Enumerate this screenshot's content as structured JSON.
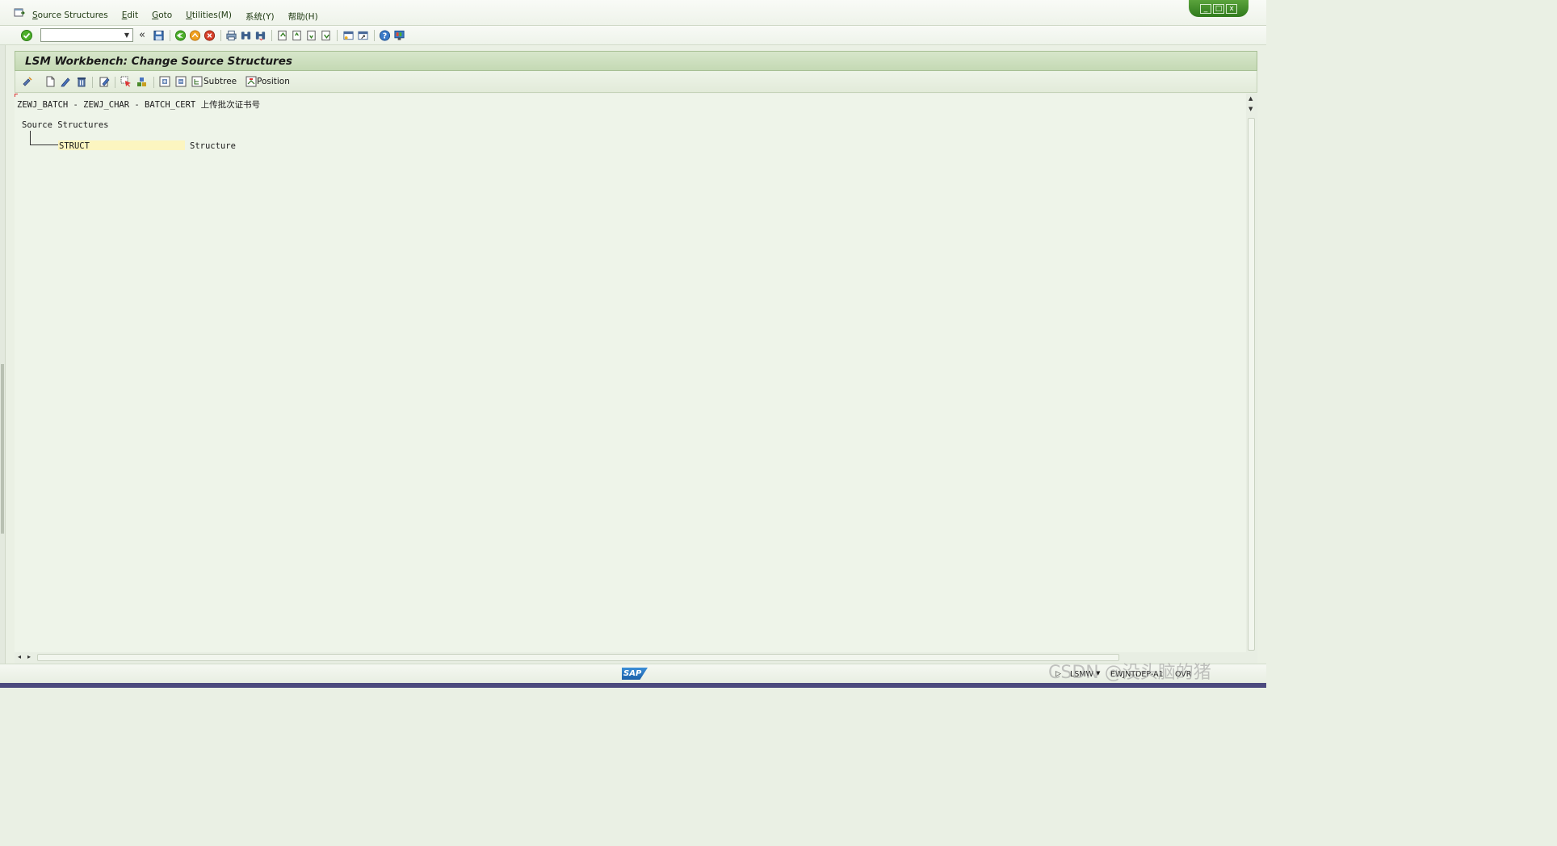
{
  "menu": {
    "items": [
      {
        "label": "Source Structures",
        "ul": "S"
      },
      {
        "label": "Edit",
        "ul": "E"
      },
      {
        "label": "Goto",
        "ul": "G"
      },
      {
        "label": "Utilities(M)",
        "ul": "U"
      },
      {
        "label": "系统(Y)",
        "ul": ""
      },
      {
        "label": "帮助(H)",
        "ul": ""
      }
    ]
  },
  "window": {
    "min": "_",
    "max": "□",
    "close": "x"
  },
  "toolbar": {
    "command_value": "",
    "back_glyph": "«"
  },
  "page": {
    "title": "LSM Workbench: Change Source Structures"
  },
  "app_toolbar": {
    "subtree_label": "Subtree",
    "position_label": "Position"
  },
  "content": {
    "header_line": "ZEWJ_BATCH - ZEWJ_CHAR - BATCH_CERT 上传批次证书号",
    "tree_root": "Source Structures",
    "struct_name": "STRUCT",
    "struct_desc": "Structure"
  },
  "status": {
    "transaction": "LSMW",
    "server": "EWJNTDEP-A1",
    "mode": "OVR"
  },
  "watermark": "CSDN @没头脑的猪",
  "colors": {
    "title_bg": "#c4d9b4",
    "content_bg": "#eef4e9",
    "highlight": "#fcf5c0",
    "sap_blue": "#1b5fa8"
  }
}
